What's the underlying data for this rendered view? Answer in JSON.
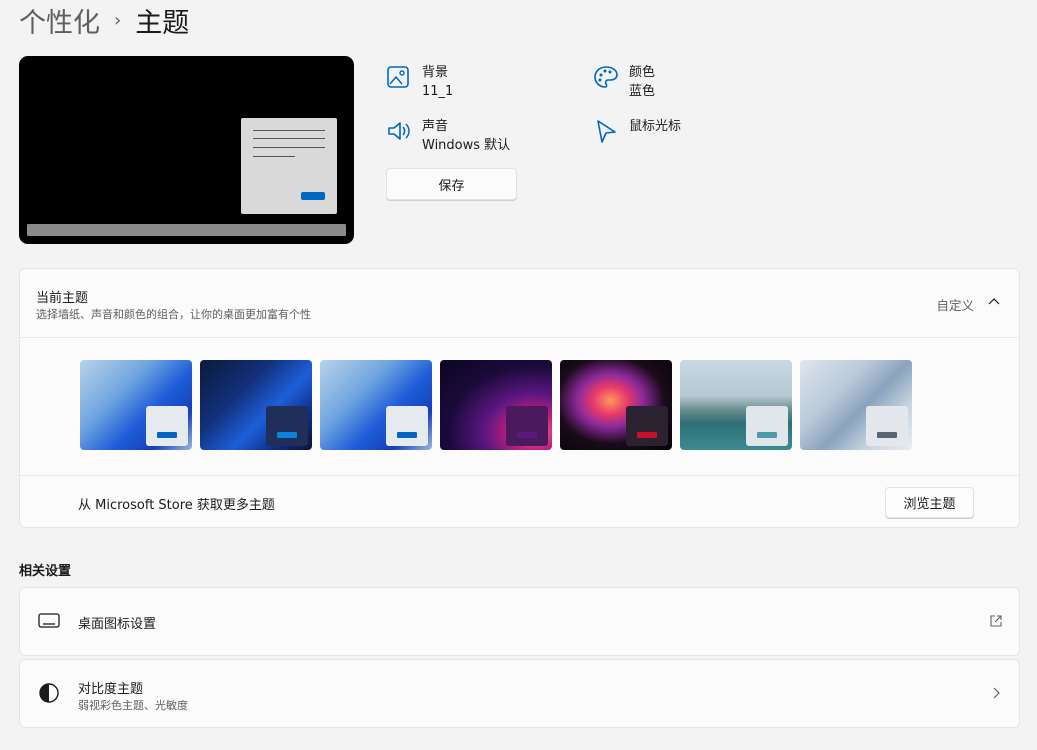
{
  "breadcrumb": {
    "parent": "个性化",
    "separator": "›",
    "current": "主题"
  },
  "quick_settings": {
    "background": {
      "title": "背景",
      "value": "11_1",
      "icon": "image-icon"
    },
    "color": {
      "title": "颜色",
      "value": "蓝色",
      "icon": "palette-icon"
    },
    "sound": {
      "title": "声音",
      "value": "Windows 默认",
      "icon": "speaker-icon"
    },
    "cursor": {
      "title": "鼠标光标",
      "icon": "cursor-icon"
    },
    "save_label": "保存"
  },
  "current_theme": {
    "title": "当前主题",
    "subtitle": "选择墙纸、声音和颜色的组合，让你的桌面更加富有个性",
    "mode": "自定义",
    "themes": [
      {
        "name": "windows-light",
        "accent": "#0067c0"
      },
      {
        "name": "windows-dark",
        "accent": "#0067c0"
      },
      {
        "name": "windows-light-2",
        "accent": "#0067c0"
      },
      {
        "name": "glow",
        "accent": "#5b1a7a"
      },
      {
        "name": "captured-motion",
        "accent": "#c8102e"
      },
      {
        "name": "sunrise",
        "accent": "#4d9aa8"
      },
      {
        "name": "flow",
        "accent": "#5c6670"
      }
    ],
    "store_text": "从 Microsoft Store 获取更多主题",
    "browse_label": "浏览主题"
  },
  "related": {
    "title": "相关设置",
    "desktop_icons": {
      "label": "桌面图标设置",
      "icon": "monitor-icon",
      "trail_icon": "external-link-icon"
    },
    "contrast": {
      "label": "对比度主题",
      "sub": "弱视彩色主题、光敏度",
      "icon": "contrast-icon",
      "trail_icon": "chevron-right-icon"
    }
  },
  "colors": {
    "accent": "#0067c0",
    "icon_blue": "#0067c0"
  }
}
